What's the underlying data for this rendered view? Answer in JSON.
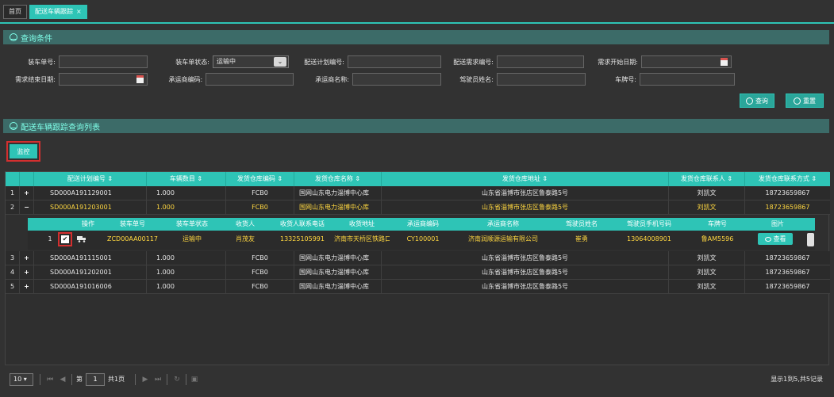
{
  "tabs": [
    {
      "label": "首页"
    },
    {
      "label": "配送车辆跟踪",
      "close": "×"
    }
  ],
  "query": {
    "title": "查询条件",
    "fields": {
      "loading_no": "装车单号:",
      "loading_status": "装车单状态:",
      "loading_status_value": "运输中",
      "plan_no": "配送计划编号:",
      "demand_no": "配送需求编号:",
      "demand_start": "需求开始日期:",
      "demand_end": "需求结束日期:",
      "carrier_code": "承运商编码:",
      "carrier_name": "承运商名称:",
      "driver_name": "驾驶员姓名:",
      "plate_no": "车牌号:"
    },
    "search_label": "查询",
    "reset_label": "重置"
  },
  "list": {
    "title": "配送车辆跟踪查询列表",
    "monitor_label": "监控",
    "columns": [
      "配送计划编号 ⇕",
      "车辆数目 ⇕",
      "发货仓库编码 ⇕",
      "发货仓库名称 ⇕",
      "发货仓库地址 ⇕",
      "发货仓库联系人 ⇕",
      "发货仓库联系方式 ⇕"
    ],
    "rows": [
      {
        "idx": "1",
        "pm": "+",
        "plan": "SD000A191129001",
        "count": "1.000",
        "code": "FCB0",
        "name": "国网山东电力淄博中心库",
        "addr": "山东省淄博市张店区鲁泰路5号",
        "contact": "刘凯文",
        "phone": "18723659867"
      },
      {
        "idx": "2",
        "pm": "−",
        "plan": "SD000A191203001",
        "count": "1.000",
        "code": "FCB0",
        "name": "国网山东电力淄博中心库",
        "addr": "山东省淄博市张店区鲁泰路5号",
        "contact": "刘凯文",
        "phone": "18723659867"
      },
      {
        "idx": "3",
        "pm": "+",
        "plan": "SD000A191115001",
        "count": "1.000",
        "code": "FCB0",
        "name": "国网山东电力淄博中心库",
        "addr": "山东省淄博市张店区鲁泰路5号",
        "contact": "刘凯文",
        "phone": "18723659867"
      },
      {
        "idx": "4",
        "pm": "+",
        "plan": "SD000A191202001",
        "count": "1.000",
        "code": "FCB0",
        "name": "国网山东电力淄博中心库",
        "addr": "山东省淄博市张店区鲁泰路5号",
        "contact": "刘凯文",
        "phone": "18723659867"
      },
      {
        "idx": "5",
        "pm": "+",
        "plan": "SD000A191016006",
        "count": "1.000",
        "code": "FCB0",
        "name": "国网山东电力淄博中心库",
        "addr": "山东省淄博市张店区鲁泰路5号",
        "contact": "刘凯文",
        "phone": "18723659867"
      }
    ],
    "sub": {
      "columns": [
        "操作",
        "装车单号",
        "装车单状态",
        "收货人",
        "收货人联系电话",
        "收货地址",
        "承运商编码",
        "承运商名称",
        "驾驶员姓名",
        "驾驶员手机号码",
        "车牌号",
        "图片"
      ],
      "row": {
        "idx": "1",
        "check": "✔",
        "loading_no": "ZCD00AA00117",
        "status": "运输中",
        "receiver": "肖茂友",
        "receiver_phone": "13325105991",
        "address": "济南市天桥区铁路口村",
        "carrier_code": "CY100001",
        "carrier_name": "济南润顺源运输有限公司",
        "driver": "崔勇",
        "driver_phone": "13064008901",
        "plate": "鲁AM5596",
        "view_label": "查看"
      }
    }
  },
  "pager": {
    "page_size": "10 ▾",
    "page_prefix": "第",
    "page_value": "1",
    "page_suffix": "共1页",
    "info": "显示1到5,共5记录"
  },
  "colors": {
    "accent": "#2ec4b6",
    "highlight": "#ffd740",
    "alert": "#d32f2f"
  }
}
